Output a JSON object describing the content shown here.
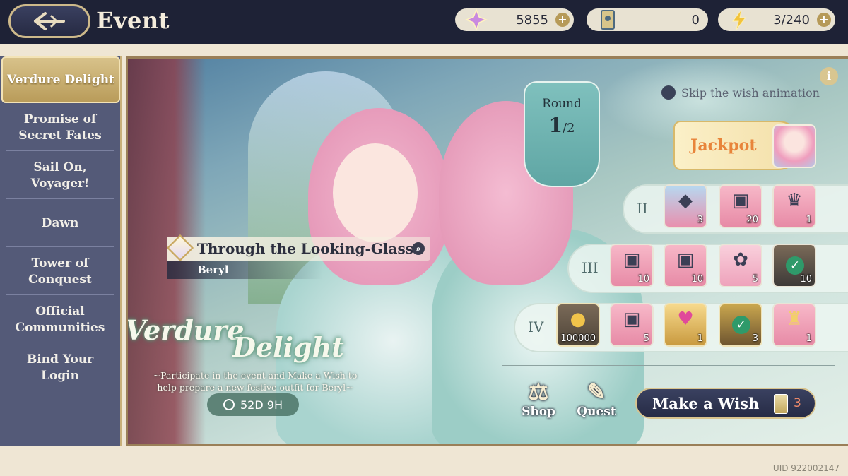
{
  "header": {
    "title": "Event",
    "resources": [
      {
        "icon": "star-crystal-icon",
        "value": "5855",
        "plus": "+"
      },
      {
        "icon": "wish-ticket-icon",
        "value": "0",
        "plus": ""
      },
      {
        "icon": "stamina-bolt-icon",
        "value": "3/240",
        "plus": "+"
      }
    ]
  },
  "sidebar": {
    "items": [
      {
        "label": "Verdure Delight",
        "active": true
      },
      {
        "label": "Promise of Secret Fates"
      },
      {
        "label": "Sail On, Voyager!"
      },
      {
        "label": "Dawn"
      },
      {
        "label": "Tower of Conquest"
      },
      {
        "label": "Official Communities"
      },
      {
        "label": "Bind Your Login"
      }
    ]
  },
  "main": {
    "info_icon": "i",
    "skip_label": "Skip the wish animation",
    "round": {
      "label": "Round",
      "current": "1",
      "total": "/2"
    },
    "jackpot_label": "Jackpot",
    "tiers": [
      {
        "label": "II",
        "rewards": [
          {
            "icon": "crystal-icon",
            "qty": "3"
          },
          {
            "icon": "chest-icon",
            "qty": "20"
          },
          {
            "icon": "pink-outfit-icon",
            "qty": "1"
          }
        ]
      },
      {
        "label": "III",
        "rewards": [
          {
            "icon": "chest-icon",
            "qty": "10"
          },
          {
            "icon": "chest-icon",
            "qty": "10"
          },
          {
            "icon": "pink-fluff-icon",
            "qty": "5"
          },
          {
            "icon": "chest-icon",
            "qty": "10",
            "claimed": true
          }
        ]
      },
      {
        "label": "IV",
        "rewards": [
          {
            "icon": "gold-coin-icon",
            "qty": "100000"
          },
          {
            "icon": "chest-icon",
            "qty": "5"
          },
          {
            "icon": "heart-gem-icon",
            "qty": "1"
          },
          {
            "icon": "blue-drop-icon",
            "qty": "3",
            "claimed": true
          },
          {
            "icon": "golden-lamp-icon",
            "qty": "1"
          }
        ]
      }
    ],
    "character": {
      "outfit_name": "Through the Looking-Glass",
      "name": "Beryl"
    },
    "logo_line1": "Verdure",
    "logo_line2": "Delight",
    "description": "~Participate in the event and Make a Wish to help prepare a new festive outfit for Beryl~",
    "timer": "52D 9H",
    "shop_label": "Shop",
    "quest_label": "Quest",
    "wish_label": "Make a Wish",
    "wish_cost": "3"
  },
  "uid": "UID 922002147",
  "colors": {
    "accent_gold": "#cdb98a",
    "topbar": "#1e2236",
    "sidebar": "#545a78",
    "jackpot_text": "#e8843a"
  }
}
